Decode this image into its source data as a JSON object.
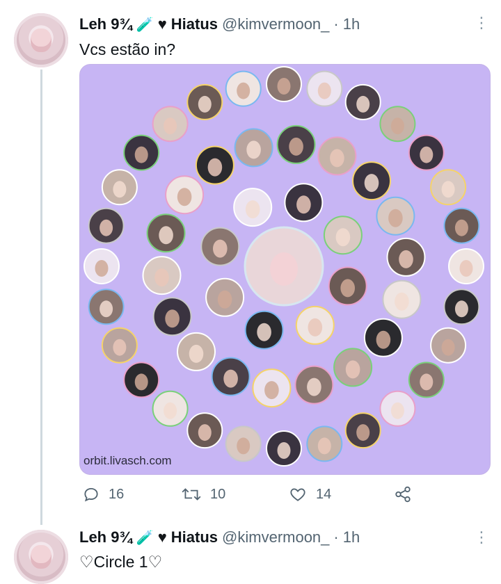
{
  "tweet1": {
    "display_name": "Leh 9¾",
    "tag": "Hiatus",
    "handle": "@kimvermoon_",
    "dot": "·",
    "time": "1h",
    "text": "Vcs estão in?",
    "watermark": "orbit.livasch.com",
    "replies": "16",
    "retweets": "10",
    "likes": "14",
    "icons": [
      "vial-icon",
      "black-heart-icon",
      "more-options-icon",
      "reply-icon",
      "retweet-icon",
      "like-icon",
      "share-icon"
    ]
  },
  "tweet2": {
    "display_name": "Leh 9¾",
    "tag": "Hiatus",
    "handle": "@kimvermoon_",
    "dot": "·",
    "time": "1h",
    "text": "♡Circle 1♡"
  },
  "colors": {
    "media_background": "#c7b5f4",
    "muted_text": "#536471",
    "thread_line": "#cfd9de"
  }
}
